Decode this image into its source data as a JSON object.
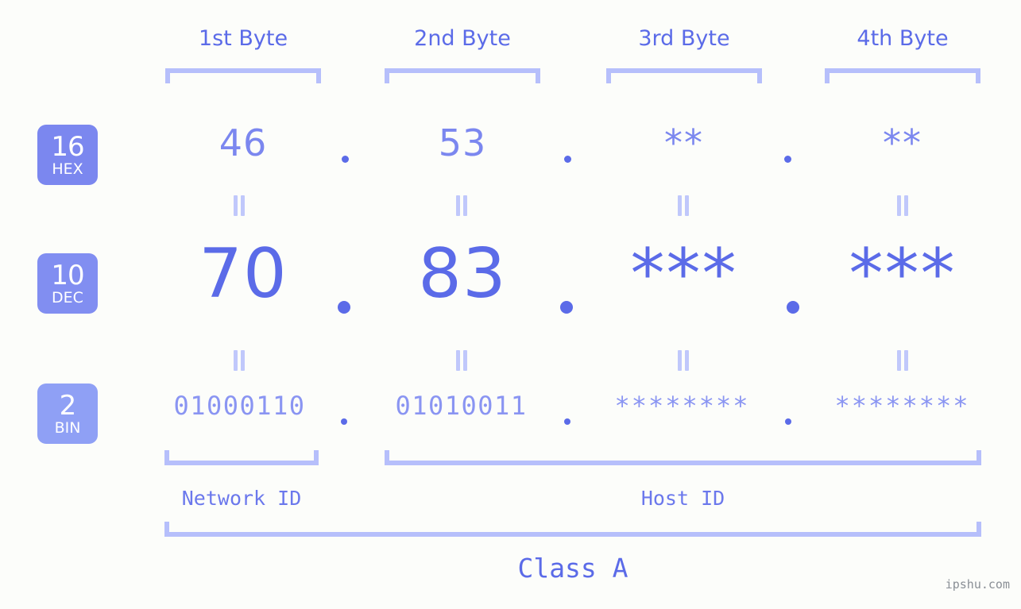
{
  "meta": {
    "watermark": "ipshu.com",
    "background_color": "#fcfdfa",
    "accent_color": "#5b6be8",
    "accent_light_color": "#b6bffb",
    "badge_color": "#7b87ef",
    "badge_color_light": "#8fa0f5"
  },
  "byte_headers": [
    {
      "label": "1st Byte"
    },
    {
      "label": "2nd Byte"
    },
    {
      "label": "3rd Byte"
    },
    {
      "label": "4th Byte"
    }
  ],
  "bases": [
    {
      "num": "16",
      "name": "HEX"
    },
    {
      "num": "10",
      "name": "DEC"
    },
    {
      "num": "2",
      "name": "BIN"
    }
  ],
  "rows": {
    "hex": {
      "base": "16",
      "base_name": "HEX",
      "values": [
        "46",
        "53",
        "**",
        "**"
      ]
    },
    "dec": {
      "base": "10",
      "base_name": "DEC",
      "values": [
        "70",
        "83",
        "***",
        "***"
      ]
    },
    "bin": {
      "base": "2",
      "base_name": "BIN",
      "values": [
        "01000110",
        "01010011",
        "********",
        "********"
      ]
    }
  },
  "separator": ".",
  "equality_symbol": "=",
  "segments": {
    "network_id": "Network ID",
    "host_id": "Host ID",
    "class": "Class A"
  }
}
